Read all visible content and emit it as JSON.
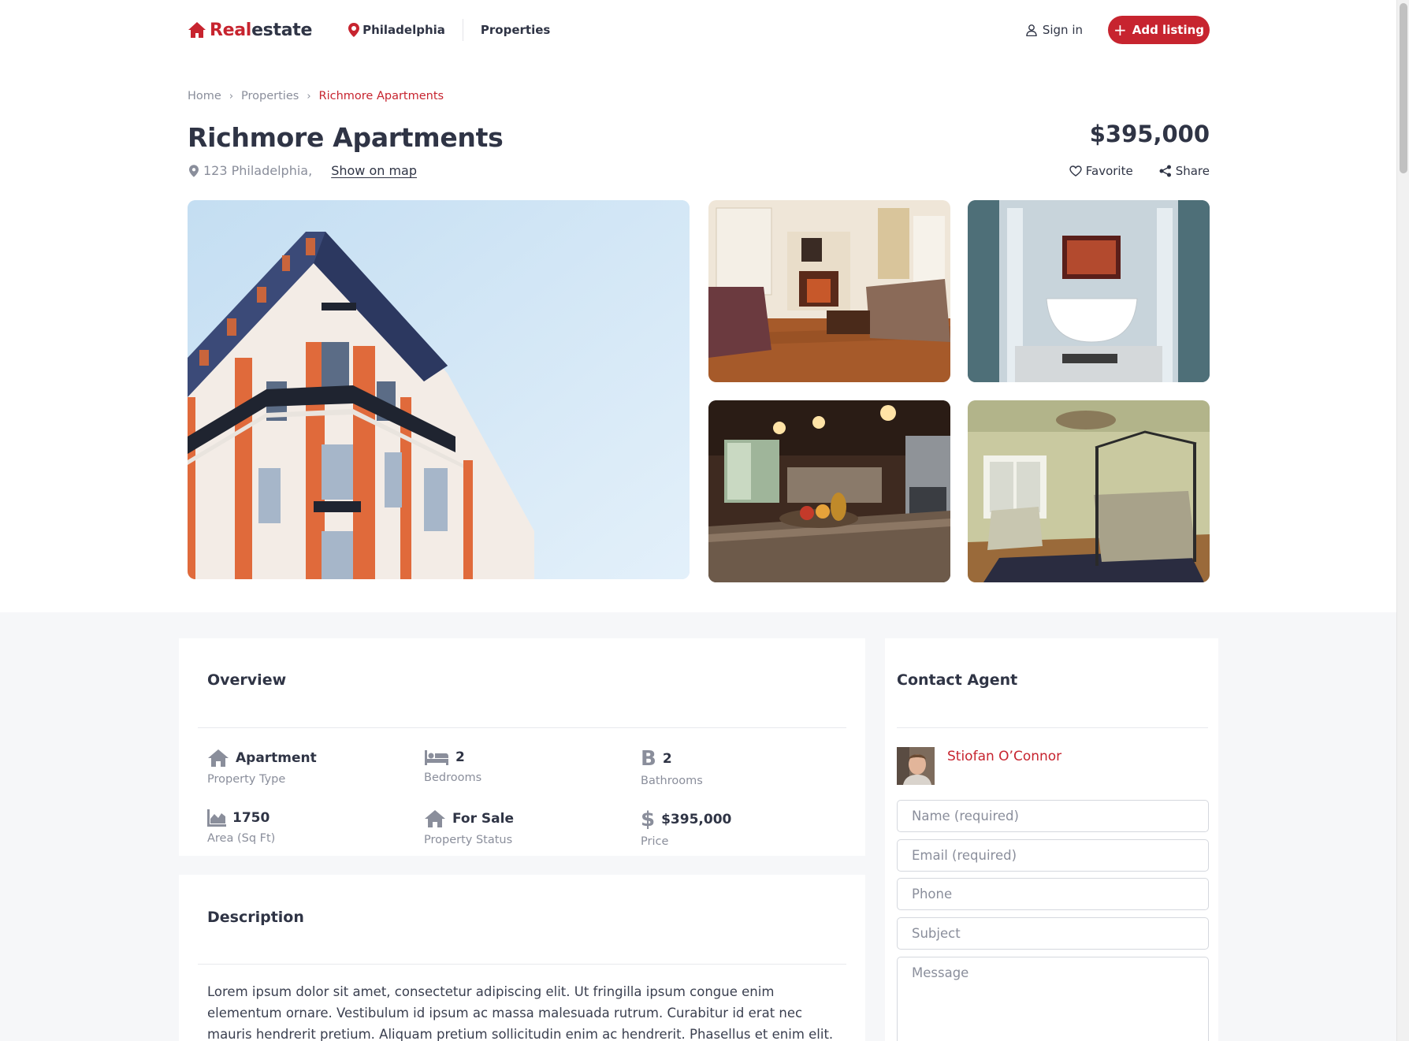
{
  "header": {
    "logo_red": "Real",
    "logo_dark": "estate",
    "city": "Philadelphia",
    "properties_link": "Properties",
    "sign_in": "Sign in",
    "add_listing": "Add listing"
  },
  "breadcrumb": {
    "home": "Home",
    "properties": "Properties",
    "current": "Richmore Apartments"
  },
  "listing": {
    "title": "Richmore Apartments",
    "price": "$395,000",
    "address": "123 Philadelphia,",
    "show_on_map": "Show on map",
    "favorite": "Favorite",
    "share": "Share"
  },
  "gallery": {
    "main": "building-facade-photo",
    "thumbs": [
      "living-room-photo",
      "bathroom-photo",
      "kitchen-photo",
      "bedroom-photo"
    ]
  },
  "overview": {
    "title": "Overview",
    "features": [
      {
        "icon": "home-icon",
        "value": "Apartment",
        "label": "Property Type"
      },
      {
        "icon": "bed-icon",
        "value": "2",
        "label": "Bedrooms"
      },
      {
        "icon": "bath-icon",
        "value": "2",
        "label": "Bathrooms"
      },
      {
        "icon": "area-chart-icon",
        "value": "1750",
        "label": "Area (Sq Ft)"
      },
      {
        "icon": "home-icon",
        "value": "For Sale",
        "label": "Property Status"
      },
      {
        "icon": "dollar-icon",
        "value": "$395,000",
        "label": "Price"
      }
    ]
  },
  "description": {
    "title": "Description",
    "text": "Lorem ipsum dolor sit amet, consectetur adipiscing elit. Ut fringilla ipsum congue enim elementum ornare. Vestibulum id ipsum ac massa malesuada rutrum. Curabitur id erat nec mauris hendrerit pretium. Aliquam pretium sollicitudin enim ac hendrerit. Phasellus et enim elit. Mauris ac maximus enim. Pellentesque habitant morbi tristique senectus et netus et malesuada fames ac turpis"
  },
  "contact": {
    "title": "Contact Agent",
    "agent_name": "Stiofan O’Connor",
    "fields": {
      "name": "Name (required)",
      "email": "Email (required)",
      "phone": "Phone",
      "subject": "Subject",
      "message": "Message"
    }
  },
  "colors": {
    "accent": "#c7242f",
    "text": "#2f3445",
    "muted": "#8a8e9b",
    "section_bg": "#f6f7f9"
  }
}
